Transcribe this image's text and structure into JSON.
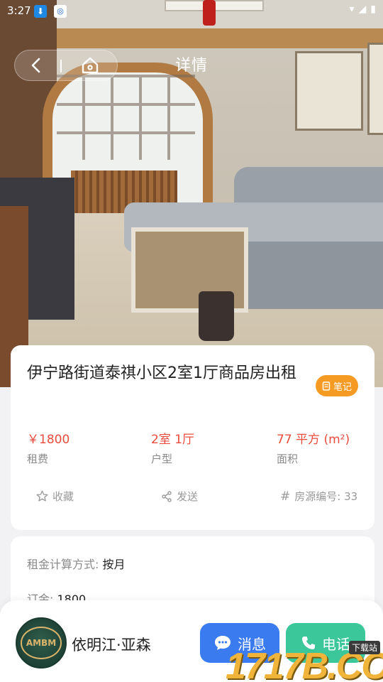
{
  "status_bar": {
    "time": "3:27"
  },
  "nav": {
    "title": "详情"
  },
  "listing": {
    "title": "伊宁路街道泰祺小区2室1厅商品房出租",
    "note_badge": "笔记",
    "stats": [
      {
        "value": "￥1800",
        "label": "租费"
      },
      {
        "value": "2室 1厅",
        "label": "户型"
      },
      {
        "value": "77 平方 (m²)",
        "label": "面积"
      }
    ],
    "actions": {
      "favorite": "收藏",
      "send": "发送",
      "listing_id": "房源编号: 33"
    }
  },
  "details": [
    {
      "key": "租金计算方式: ",
      "value": "按月"
    },
    {
      "key": "订金: ",
      "value": "1800"
    }
  ],
  "agent": {
    "name": "依明江·亚森",
    "avatar_text": "AMBM"
  },
  "buttons": {
    "message": "消息",
    "call": "电话"
  },
  "watermark": {
    "text": "1717B.COM",
    "tag": "下载站"
  },
  "colors": {
    "price_red": "#e94b3c",
    "badge_orange": "#f59a23",
    "message_blue": "#3a7bf0",
    "call_green": "#3cc79a"
  }
}
